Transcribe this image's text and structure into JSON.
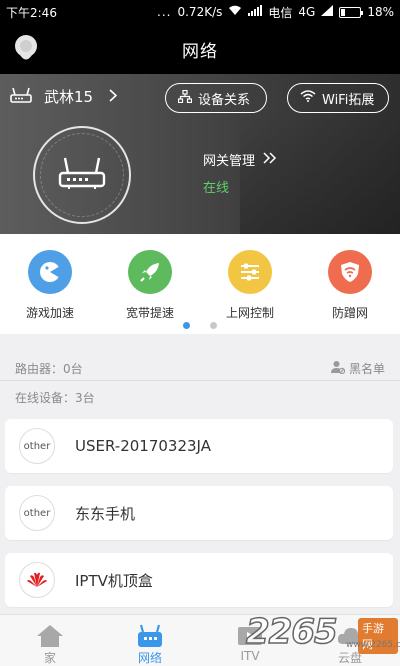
{
  "status_bar": {
    "time": "下午2:46",
    "indicator": "...",
    "speed": "0.72K/s",
    "carrier": "电信",
    "network": "4G",
    "battery": "18%"
  },
  "header": {
    "title": "网络"
  },
  "hero": {
    "router_name": "武林15",
    "device_relation_label": "设备关系",
    "wifi_extend_label": "WiFi拓展",
    "gateway_label": "网关管理",
    "gateway_status": "在线"
  },
  "tools": [
    {
      "label": "游戏加速",
      "icon": "game-icon",
      "color": "#4f9fe6"
    },
    {
      "label": "宽带提速",
      "icon": "rocket-icon",
      "color": "#5dbb5d"
    },
    {
      "label": "上网控制",
      "icon": "sliders-icon",
      "color": "#f2c542"
    },
    {
      "label": "防蹭网",
      "icon": "wifi-shield-icon",
      "color": "#ef6d4e"
    }
  ],
  "pager": {
    "pages": 2,
    "active": 0
  },
  "info": {
    "router_count": "路由器：0台",
    "blacklist_label": "黑名单",
    "online_count": "在线设备：3台"
  },
  "devices": [
    {
      "icon_text": "other",
      "name": "USER-20170323JA"
    },
    {
      "icon_text": "other",
      "name": "东东手机"
    },
    {
      "icon_text": "HUAWEI",
      "name": "IPTV机顶盒"
    }
  ],
  "tabs": [
    {
      "label": "家",
      "icon": "home-icon",
      "active": false
    },
    {
      "label": "网络",
      "icon": "network-icon",
      "active": true
    },
    {
      "label": "ITV",
      "icon": "tv-icon",
      "active": false
    },
    {
      "label": "云盘",
      "icon": "cloud-icon",
      "active": false
    }
  ],
  "watermark": {
    "number": "2265",
    "dot_com": ".com",
    "cn_label": "手游网",
    "url": "www.2265.com"
  },
  "colors": {
    "accent_blue": "#3b97e8",
    "online_green": "#5dd06b",
    "page_bg": "#f0f0f2"
  }
}
